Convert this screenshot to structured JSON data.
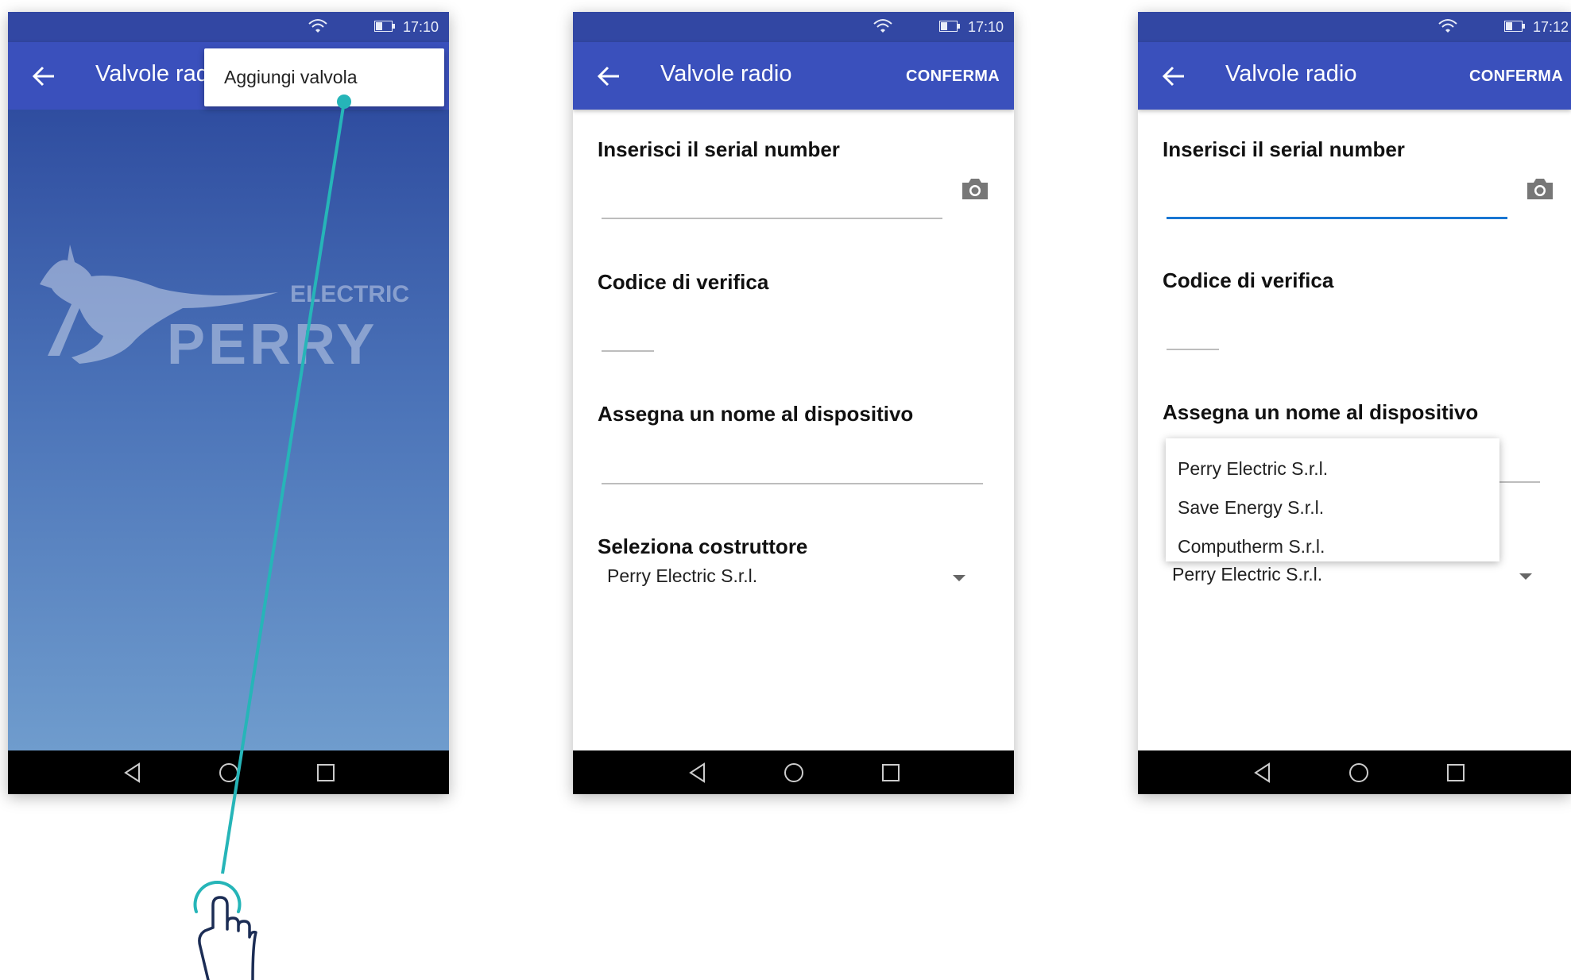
{
  "status_bar": {
    "screen1_time": "17:10",
    "screen2_time": "17:10",
    "screen3_time": "17:12"
  },
  "app_bar": {
    "title": "Valvole radio",
    "confirm_label": "CONFERMA"
  },
  "menu": {
    "add_valve_label": "Aggiungi valvola"
  },
  "logo": {
    "top_word": "ELECTRIC",
    "brand": "PERRY"
  },
  "form": {
    "serial_label": "Inserisci il serial number",
    "verify_label": "Codice di verifica",
    "name_label": "Assegna un nome al dispositivo",
    "manufacturer_label": "Seleziona costruttore",
    "manufacturer_value": "Perry Electric S.r.l."
  },
  "manufacturer_options": [
    "Perry Electric S.r.l.",
    "Save Energy S.r.l.",
    "Computherm S.r.l."
  ],
  "icons": [
    "wifi-icon",
    "battery-icon",
    "back-arrow-icon",
    "camera-icon",
    "nav-back-icon",
    "nav-home-icon",
    "nav-recents-icon",
    "tap-hand-icon"
  ],
  "colors": {
    "app_bar": "#3a50bc",
    "status_bar": "#3247a3",
    "accent_line": "#1976d2",
    "pointer_line": "#26b5b8"
  }
}
